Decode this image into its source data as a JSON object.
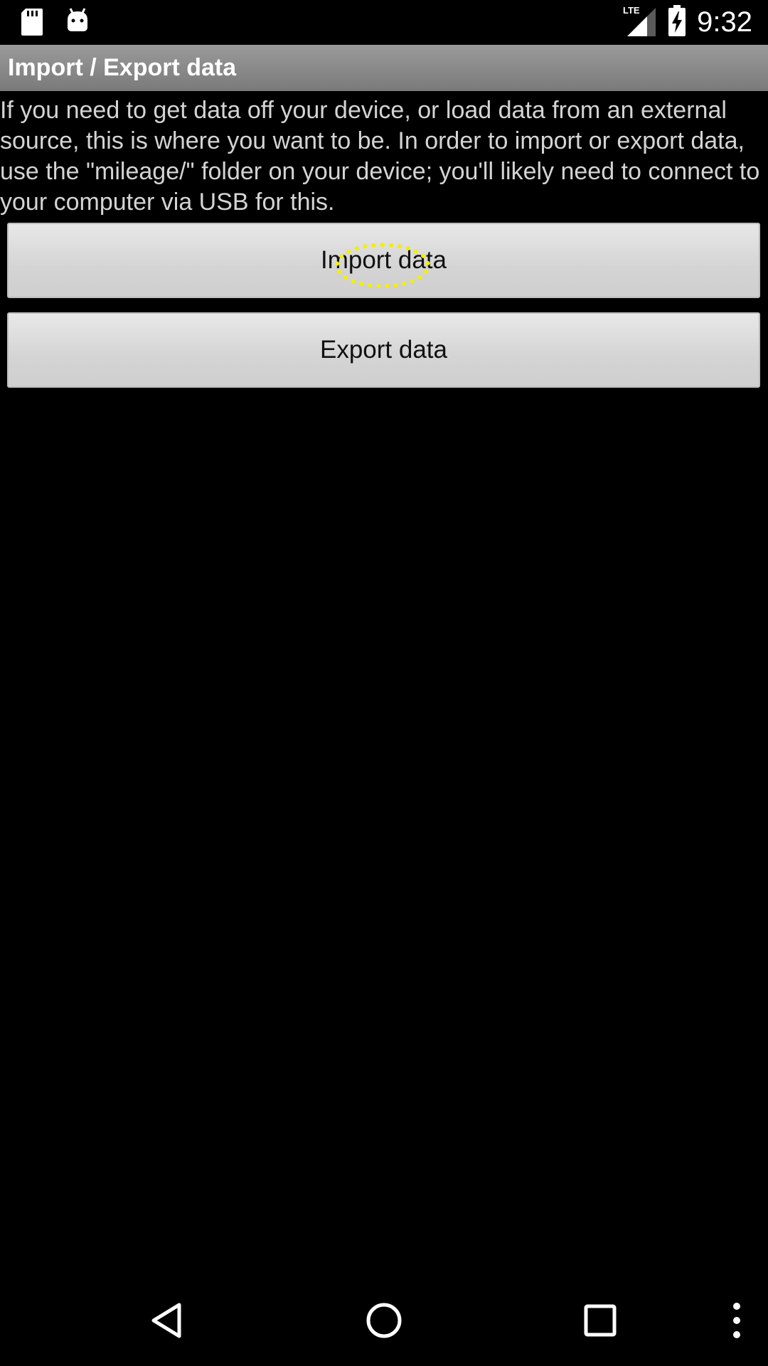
{
  "status_bar": {
    "time": "9:32",
    "network": "LTE",
    "left_icons": [
      "sd-card-icon",
      "android-debug-icon"
    ]
  },
  "title_bar": {
    "title": "Import / Export data"
  },
  "description": "If you need to get data off your device, or load data from an external source, this is where you want to be. In order to import or export data, use the \"mileage/\" folder on your device; you'll likely need to connect to your computer via USB for this.",
  "buttons": {
    "import_label": "Import data",
    "export_label": "Export data"
  },
  "nav_bar": {
    "icons": [
      "back-icon",
      "home-icon",
      "recents-icon",
      "overflow-menu-icon"
    ]
  },
  "colors": {
    "title_bar_bg": "#8a8a8a",
    "text": "#d4d4d4",
    "touch_indicator": "#f2f000"
  }
}
